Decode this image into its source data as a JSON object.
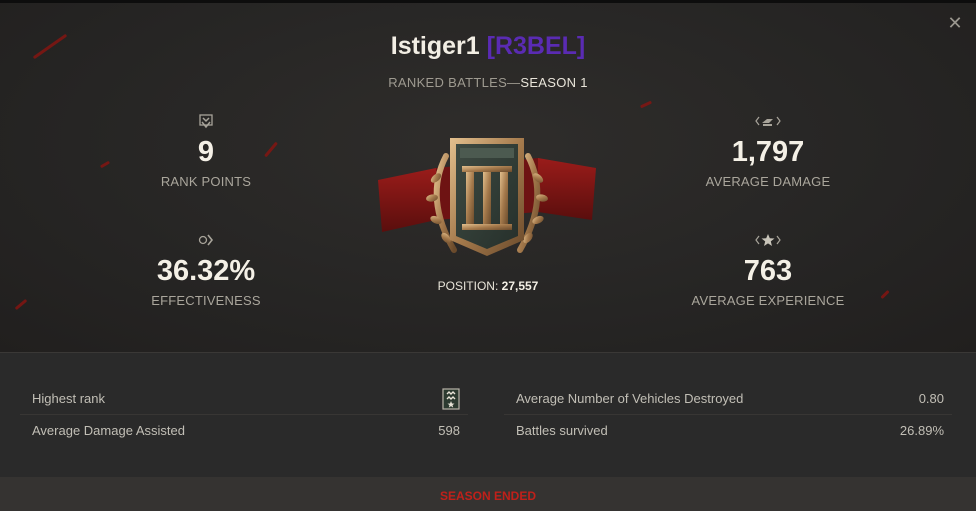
{
  "header": {
    "player_name": "Istiger1",
    "clan_tag": "[R3BEL]",
    "subtitle_prefix": "RANKED BATTLES—",
    "season": "SEASON 1",
    "close_icon": "close-icon"
  },
  "stats": {
    "rank_points": {
      "icon": "rank-chevron-icon",
      "value": "9",
      "label": "RANK POINTS"
    },
    "effectiveness": {
      "icon": "effectiveness-icon",
      "value": "36.32%",
      "label": "EFFECTIVENESS"
    },
    "average_damage": {
      "icon": "damage-icon",
      "value": "1,797",
      "label": "AVERAGE DAMAGE"
    },
    "average_experience": {
      "icon": "experience-star-icon",
      "value": "763",
      "label": "AVERAGE EXPERIENCE"
    }
  },
  "emblem": {
    "icon": "league-emblem-icon",
    "numeral": "III",
    "position_label": "POSITION:",
    "position_value": "27,557"
  },
  "details": {
    "left": [
      {
        "label": "Highest rank",
        "value": "",
        "icon": "rank-insignia-icon"
      },
      {
        "label": "Average Damage Assisted",
        "value": "598"
      }
    ],
    "right": [
      {
        "label": "Average Number of Vehicles Destroyed",
        "value": "0.80"
      },
      {
        "label": "Battles survived",
        "value": "26.89%"
      }
    ]
  },
  "footer": {
    "status": "SEASON ENDED"
  },
  "colors": {
    "clan_tag": "#5a2bb3",
    "status": "#c0201a",
    "emblem_ribbon": "#7d1414",
    "emblem_bronze": "#b58a5a"
  }
}
